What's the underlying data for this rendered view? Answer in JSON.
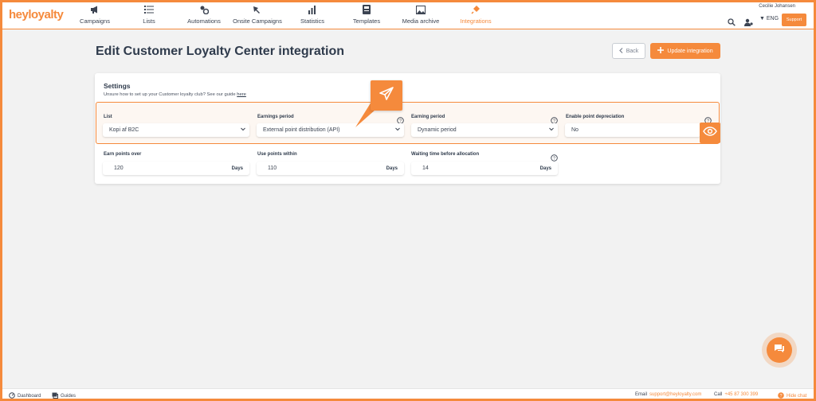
{
  "app": {
    "logo": "heyloyalty"
  },
  "nav": {
    "items": [
      {
        "label": "Campaigns",
        "icon": "megaphone-icon"
      },
      {
        "label": "Lists",
        "icon": "list-icon"
      },
      {
        "label": "Automations",
        "icon": "automation-icon"
      },
      {
        "label": "Onsite Campaigns",
        "icon": "onsite-icon"
      },
      {
        "label": "Statistics",
        "icon": "chart-icon"
      },
      {
        "label": "Templates",
        "icon": "template-icon"
      },
      {
        "label": "Media archive",
        "icon": "image-icon"
      },
      {
        "label": "Integrations",
        "icon": "plug-icon"
      }
    ],
    "active": "Integrations"
  },
  "topbar": {
    "user_name": "Cecilie Johansen",
    "language": "ENG",
    "support_label": "Support"
  },
  "page": {
    "title": "Edit Customer Loyalty Center integration",
    "back_label": "Back",
    "update_label": "Update integration"
  },
  "settings": {
    "title": "Settings",
    "subtitle": "Unsure how to set up your Customer loyalty club? See our guide",
    "guide_link": "here",
    "list": {
      "label": "List",
      "value": "Kopi af B2C"
    },
    "earnings_period": {
      "label": "Earnings period",
      "value": "External point distribution (API)"
    },
    "earning_period": {
      "label": "Earning period",
      "value": "Dynamic period"
    },
    "depreciation": {
      "label": "Enable point depreciation",
      "value": "No"
    },
    "earn_points_over": {
      "label": "Earn points over",
      "value": "120",
      "unit": "Days"
    },
    "use_points_within": {
      "label": "Use points within",
      "value": "110",
      "unit": "Days"
    },
    "waiting_time": {
      "label": "Waiting time before allocation",
      "value": "14",
      "unit": "Days"
    }
  },
  "footer": {
    "dashboard": "Dashboard",
    "guides": "Guides",
    "email_label": "Email",
    "email": "support@heyloyalty.com",
    "call_label": "Call",
    "phone": "+45 87 300 399",
    "hide_chat": "Hide chat"
  },
  "colors": {
    "accent": "#f58a3c",
    "text": "#2f3b4c"
  }
}
